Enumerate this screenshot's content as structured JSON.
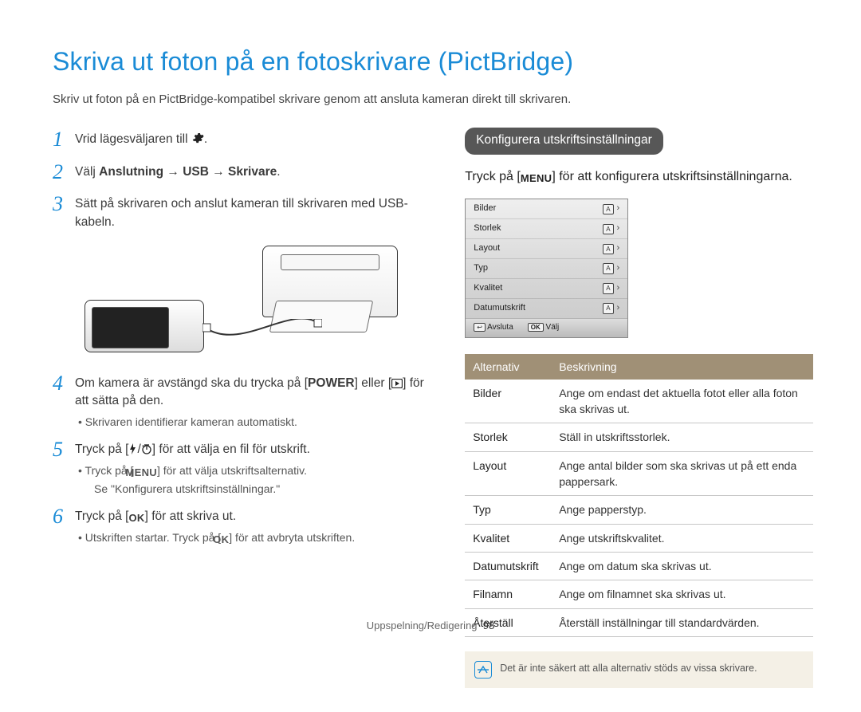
{
  "title": "Skriva ut foton på en fotoskrivare (PictBridge)",
  "subtitle": "Skriv ut foton på en PictBridge-kompatibel skrivare genom att ansluta kameran direkt till skrivaren.",
  "steps": {
    "s1": {
      "num": "1",
      "text_before": "Vrid lägesväljaren till ",
      "icon": "gear-icon",
      "text_after": "."
    },
    "s2": {
      "num": "2",
      "prefix": "Välj ",
      "bold": "Anslutning → USB → Skrivare",
      "suffix": "."
    },
    "s3": {
      "num": "3",
      "text": "Sätt på skrivaren och anslut kameran till skrivaren med USB-kabeln."
    },
    "s4": {
      "num": "4",
      "line_a": "Om kamera är avstängd ska du trycka på [",
      "power": "POWER",
      "line_b": "] eller [",
      "icon": "play-icon",
      "line_c": "] för att sätta på den.",
      "sub1": "•  Skrivaren identifierar kameran automatiskt."
    },
    "s5": {
      "num": "5",
      "line_a": "Tryck på [",
      "icon1": "flash-icon",
      "sep": "/",
      "icon2": "timer-icon",
      "line_b": "] för att välja en fil för utskrift.",
      "sub1": "•  Tryck på [",
      "menu": "MENU",
      "sub1b": "] för att välja utskriftsalternativ.",
      "sub2": "Se \"Konfigurera utskriftsinställningar.\""
    },
    "s6": {
      "num": "6",
      "line_a": "Tryck på [",
      "ok": "OK",
      "line_b": "] för att skriva ut.",
      "sub1": "•  Utskriften startar. Tryck på [",
      "ok2": "OK",
      "sub1b": "] för att avbryta utskriften."
    }
  },
  "right": {
    "header": "Konfigurera utskriftsinställningar",
    "intro_a": "Tryck på [",
    "intro_menu": "MENU",
    "intro_b": "] för att konfigurera utskriftsinställningarna."
  },
  "menu_items": [
    {
      "label": "Bilder",
      "badge": "A"
    },
    {
      "label": "Storlek",
      "badge": "A"
    },
    {
      "label": "Layout",
      "badge": "A"
    },
    {
      "label": "Typ",
      "badge": "A"
    },
    {
      "label": "Kvalitet",
      "badge": "A"
    },
    {
      "label": "Datumutskrift",
      "badge": "A"
    }
  ],
  "menu_footer": {
    "exit": "Avsluta",
    "select": "Välj"
  },
  "table": {
    "head_option": "Alternativ",
    "head_desc": "Beskrivning",
    "rows": [
      {
        "opt": "Bilder",
        "desc": "Ange om endast det aktuella fotot eller alla foton ska skrivas ut."
      },
      {
        "opt": "Storlek",
        "desc": "Ställ in utskriftsstorlek."
      },
      {
        "opt": "Layout",
        "desc": "Ange antal bilder som ska skrivas ut på ett enda pappersark."
      },
      {
        "opt": "Typ",
        "desc": "Ange papperstyp."
      },
      {
        "opt": "Kvalitet",
        "desc": "Ange utskriftskvalitet."
      },
      {
        "opt": "Datumutskrift",
        "desc": "Ange om datum ska skrivas ut."
      },
      {
        "opt": "Filnamn",
        "desc": "Ange om filnamnet ska skrivas ut."
      },
      {
        "opt": "Återställ",
        "desc": "Återställ inställningar till standardvärden."
      }
    ]
  },
  "note": "Det är inte säkert att alla alternativ stöds av vissa skrivare.",
  "footer": {
    "section": "Uppspelning/Redigering",
    "page": "98"
  },
  "chart_data": null
}
